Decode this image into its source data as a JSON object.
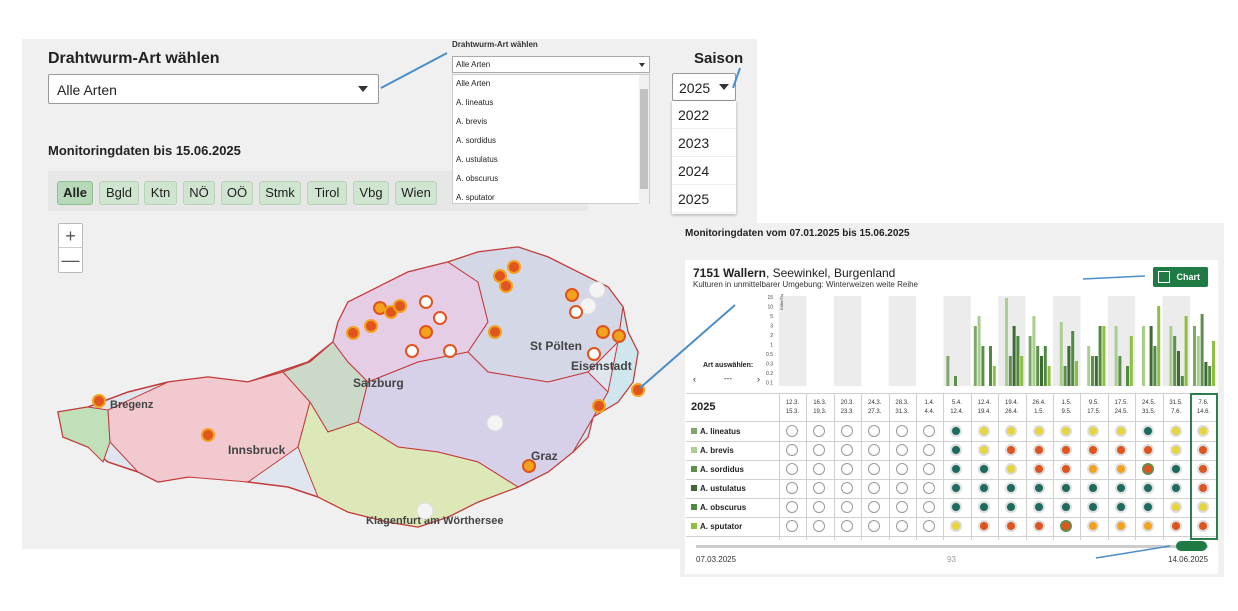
{
  "left": {
    "species_title": "Drahtwurm-Art wählen",
    "species_selected": "Alle Arten",
    "monitor_title": "Monitoringdaten bis 15.06.2025",
    "regions": [
      "Alle",
      "Bgld",
      "Ktn",
      "NÖ",
      "OÖ",
      "Stmk",
      "Tirol",
      "Vbg",
      "Wien"
    ],
    "active_region": "Alle",
    "zoom_in": "+",
    "zoom_out": "—",
    "map_labels": [
      "Bregenz",
      "Innsbruck",
      "Salzburg",
      "St Pölten",
      "Eisenstadt",
      "Graz",
      "Klagenfurt am Wörthersee"
    ]
  },
  "dropdown_popup": {
    "label": "Drahtwurm-Art wählen",
    "selected": "Alle Arten",
    "options": [
      "Alle Arten",
      "A. lineatus",
      "A. brevis",
      "A. sordidus",
      "A. ustulatus",
      "A. obscurus",
      "A. sputator"
    ]
  },
  "saison": {
    "title": "Saison",
    "selected": "2025",
    "options": [
      "2022",
      "2023",
      "2024",
      "2025"
    ]
  },
  "detail": {
    "title": "Monitoringdaten vom 07.01.2025 bis 15.06.2025",
    "location_bold": "7151 Wallern",
    "location_rest": ", Seewinkel, Burgenland",
    "subtitle": "Kulturen in unmittelbarer Umgebung: Winterweizen weite Reihe",
    "chart_button": "Chart",
    "art_label": "Art auswählen:",
    "art_value": "---",
    "year": "2025",
    "columns": [
      "12.3.\n15.3.",
      "16.3.\n19.3.",
      "20.3.\n23.3.",
      "24.3.\n27.3.",
      "28.3.\n31.3.",
      "1.4.\n4.4.",
      "5.4.\n12.4.",
      "12.4.\n19.4.",
      "19.4.\n26.4.",
      "26.4.\n1.5.",
      "1.5.\n9.5.",
      "9.5.\n17.5.",
      "17.5.\n24.5.",
      "24.5.\n31.5.",
      "31.5.\n7.6.",
      "7.6.\n14.6."
    ],
    "rows": [
      {
        "name": "A. lineatus",
        "color": "#7ea86a",
        "cells": [
          "e",
          "e",
          "e",
          "e",
          "e",
          "e",
          "t",
          "y",
          "y",
          "y",
          "y",
          "y",
          "y",
          "t",
          "y",
          "y"
        ]
      },
      {
        "name": "A. brevis",
        "color": "#a9cf8f",
        "cells": [
          "e",
          "e",
          "e",
          "e",
          "e",
          "e",
          "t",
          "y",
          "r",
          "r",
          "r",
          "r",
          "r",
          "r",
          "y",
          "r"
        ]
      },
      {
        "name": "A. sordidus",
        "color": "#5f8f4e",
        "cells": [
          "e",
          "e",
          "e",
          "e",
          "e",
          "e",
          "t",
          "t",
          "y",
          "r",
          "r",
          "o",
          "o",
          "g",
          "t",
          "r"
        ]
      },
      {
        "name": "A. ustulatus",
        "color": "#3d6b33",
        "cells": [
          "e",
          "e",
          "e",
          "e",
          "e",
          "e",
          "t",
          "t",
          "t",
          "t",
          "t",
          "t",
          "t",
          "t",
          "t",
          "r"
        ]
      },
      {
        "name": "A. obscurus",
        "color": "#4e8a3f",
        "cells": [
          "e",
          "e",
          "e",
          "e",
          "e",
          "e",
          "t",
          "t",
          "t",
          "t",
          "t",
          "t",
          "t",
          "t",
          "y",
          "y"
        ]
      },
      {
        "name": "A. sputator",
        "color": "#8fbf3f",
        "cells": [
          "e",
          "e",
          "e",
          "e",
          "e",
          "e",
          "y",
          "r",
          "r",
          "r",
          "g",
          "o",
          "o",
          "o",
          "r",
          "r"
        ]
      }
    ],
    "y_ticks": [
      "15",
      "10",
      "5",
      "3",
      "2",
      "1",
      "0.5",
      "0.3",
      "0.2",
      "0.1"
    ],
    "y_axis_label": "Käfer/Tag",
    "slider_start": "07.03.2025",
    "slider_mid": "93",
    "slider_end": "14.06.2025"
  },
  "colors": {
    "accent": "#1f7a44",
    "teal": "#1d6b5e",
    "yellow": "#e6d53b",
    "red": "#e0541e",
    "orange": "#f2a21d",
    "arrow": "#4a8ec9"
  }
}
